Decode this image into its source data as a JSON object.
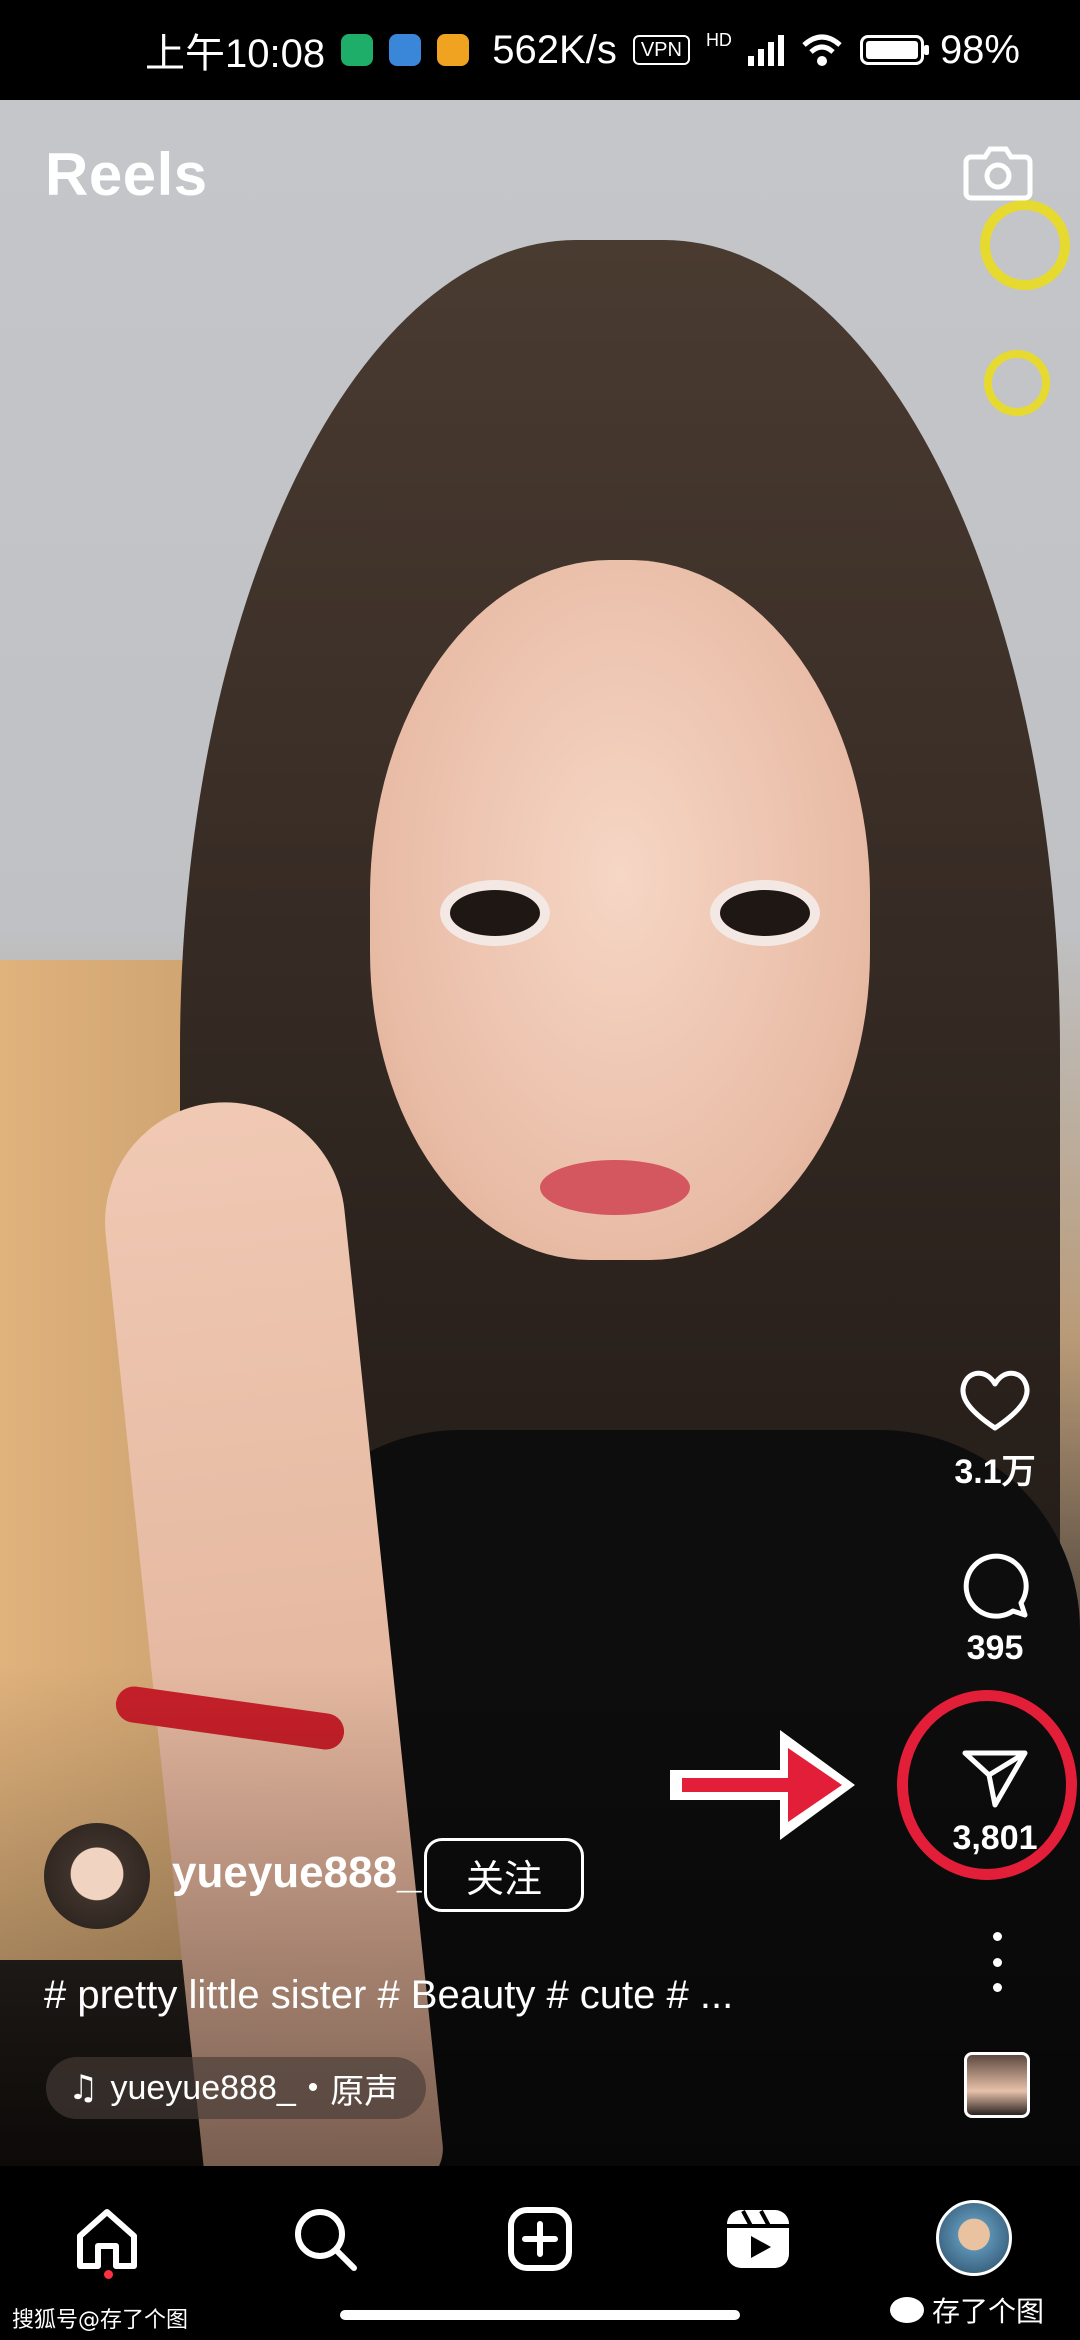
{
  "status_bar": {
    "time": "上午10:08",
    "network_speed": "562K/s",
    "vpn_label": "VPN",
    "hd_label": "HD",
    "battery": "98%"
  },
  "header": {
    "title": "Reels"
  },
  "actions": {
    "likes": "3.1万",
    "comments": "395",
    "shares": "3,801"
  },
  "post": {
    "username": "yueyue888_",
    "follow_label": "关注",
    "caption": "# pretty little sister # Beauty # cute # ...",
    "audio_user": "yueyue888_",
    "audio_separator": "•",
    "audio_label": "原声"
  },
  "watermark": {
    "left": "搜狐号@存了个图",
    "right": "存了个图"
  },
  "colors": {
    "annotation_red": "#e21e39",
    "notification_dot": "#ff3040"
  },
  "icons": [
    "camera-icon",
    "heart-icon",
    "comment-icon",
    "send-icon",
    "more-icon",
    "music-note-icon",
    "home-icon",
    "search-icon",
    "add-icon",
    "reels-icon"
  ]
}
